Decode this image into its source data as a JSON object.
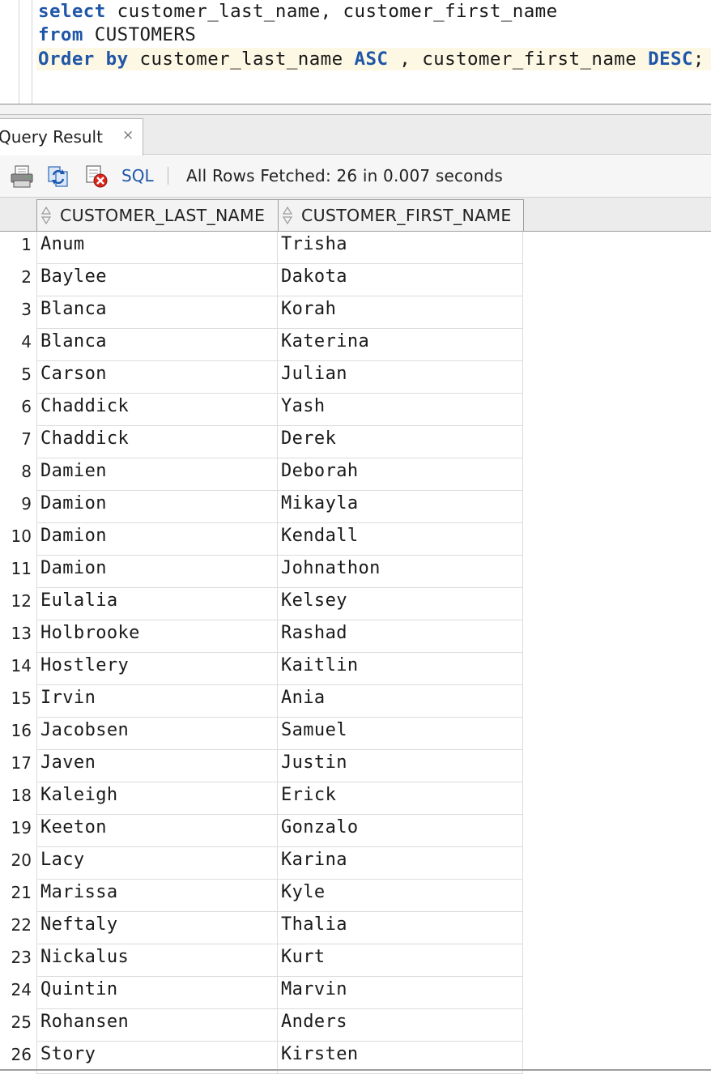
{
  "editor": {
    "lines": [
      {
        "kw1": "select",
        "text1": " customer_last_name, customer_first_name",
        "kw2": "",
        "text2": "",
        "kw3": "",
        "text3": ""
      },
      {
        "kw1": "from",
        "text1": " CUSTOMERS",
        "kw2": "",
        "text2": "",
        "kw3": "",
        "text3": ""
      },
      {
        "kw1": "Order by",
        "text1": " customer_last_name ",
        "kw2": "ASC",
        "text2": " , customer_first_name ",
        "kw3": "DESC",
        "text3": ";"
      }
    ]
  },
  "result_tab": {
    "label": "Query Result",
    "close": "×"
  },
  "toolbar": {
    "sql_label": "SQL",
    "separator": "|",
    "status": "All Rows Fetched: 26 in 0.007 seconds"
  },
  "grid": {
    "columns": [
      "CUSTOMER_LAST_NAME",
      "CUSTOMER_FIRST_NAME"
    ],
    "rows": [
      [
        "1",
        "Anum",
        "Trisha"
      ],
      [
        "2",
        "Baylee",
        "Dakota"
      ],
      [
        "3",
        "Blanca",
        "Korah"
      ],
      [
        "4",
        "Blanca",
        "Katerina"
      ],
      [
        "5",
        "Carson",
        "Julian"
      ],
      [
        "6",
        "Chaddick",
        "Yash"
      ],
      [
        "7",
        "Chaddick",
        "Derek"
      ],
      [
        "8",
        "Damien",
        "Deborah"
      ],
      [
        "9",
        "Damion",
        "Mikayla"
      ],
      [
        "10",
        "Damion",
        "Kendall"
      ],
      [
        "11",
        "Damion",
        "Johnathon"
      ],
      [
        "12",
        "Eulalia",
        "Kelsey"
      ],
      [
        "13",
        "Holbrooke",
        "Rashad"
      ],
      [
        "14",
        "Hostlery",
        "Kaitlin"
      ],
      [
        "15",
        "Irvin",
        "Ania"
      ],
      [
        "16",
        "Jacobsen",
        "Samuel"
      ],
      [
        "17",
        "Javen",
        "Justin"
      ],
      [
        "18",
        "Kaleigh",
        "Erick"
      ],
      [
        "19",
        "Keeton",
        "Gonzalo"
      ],
      [
        "20",
        "Lacy",
        "Karina"
      ],
      [
        "21",
        "Marissa",
        "Kyle"
      ],
      [
        "22",
        "Neftaly",
        "Thalia"
      ],
      [
        "23",
        "Nickalus",
        "Kurt"
      ],
      [
        "24",
        "Quintin",
        "Marvin"
      ],
      [
        "25",
        "Rohansen",
        "Anders"
      ],
      [
        "26",
        "Story",
        "Kirsten"
      ]
    ]
  },
  "icons": {
    "print": "printer-icon",
    "refresh": "refresh-icon",
    "delete": "delete-cancel-icon",
    "sort": "sort-icon"
  },
  "colors": {
    "keyword": "#1f56a8",
    "current_line": "#fdf8e4",
    "delete_red": "#d9261c"
  }
}
